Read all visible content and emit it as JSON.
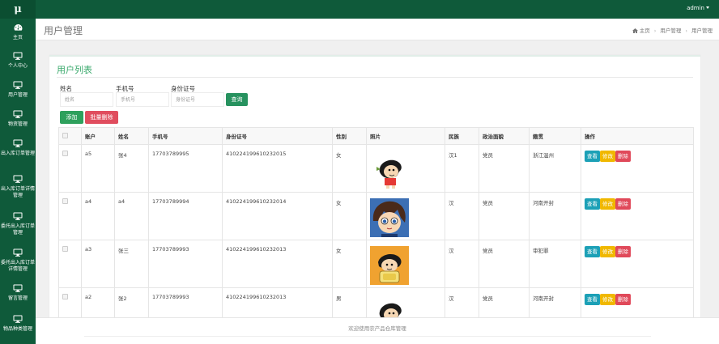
{
  "topbar": {
    "logo": "μ",
    "user": "admin"
  },
  "sidebar": {
    "items": [
      {
        "label": "主页",
        "icon": "dashboard-icon"
      },
      {
        "label": "个人中心",
        "icon": "monitor-icon"
      },
      {
        "label": "用户管理",
        "icon": "monitor-icon"
      },
      {
        "label": "物资管理",
        "icon": "monitor-icon"
      },
      {
        "label": "出入库订单管理",
        "icon": "monitor-icon"
      },
      {
        "label": "出入库订单详情管理",
        "icon": "monitor-icon"
      },
      {
        "label": "委托出入库订单管理",
        "icon": "monitor-icon"
      },
      {
        "label": "委托出入库订单详情管理",
        "icon": "monitor-icon"
      },
      {
        "label": "留言管理",
        "icon": "monitor-icon"
      },
      {
        "label": "物品种类管理",
        "icon": "monitor-icon"
      }
    ]
  },
  "header": {
    "title": "用户管理",
    "breadcrumb": [
      "主页",
      "用户管理",
      "用户管理"
    ]
  },
  "panel": {
    "title": "用户列表"
  },
  "search": {
    "name_label": "姓名",
    "name_placeholder": "姓名",
    "phone_label": "手机号",
    "phone_placeholder": "手机号",
    "idcard_label": "身份证号",
    "idcard_placeholder": "身份证号",
    "button": "查询"
  },
  "actions": {
    "add": "添加",
    "batch_delete": "批量删除"
  },
  "table": {
    "headers": [
      "账户",
      "姓名",
      "手机号",
      "身份证号",
      "性别",
      "照片",
      "民族",
      "政治面貌",
      "籍贯",
      "操作"
    ],
    "row_actions": {
      "view": "查看",
      "edit": "修改",
      "delete": "删除"
    },
    "rows": [
      {
        "account": "a5",
        "name": "张4",
        "phone": "17703789995",
        "idcard": "410224199610232015",
        "gender": "女",
        "photo": "cartoon-boy-avatar",
        "ethnicity": "汉1",
        "political": "党员",
        "hometown": "浙江温州"
      },
      {
        "account": "a4",
        "name": "a4",
        "phone": "17703789994",
        "idcard": "410224199610232014",
        "gender": "女",
        "photo": "cartoon-detective-avatar",
        "ethnicity": "汉",
        "political": "党员",
        "hometown": "河南开封"
      },
      {
        "account": "a3",
        "name": "张三",
        "phone": "17703789993",
        "idcard": "410224199610232013",
        "gender": "女",
        "photo": "cartoon-boy-backpack-avatar",
        "ethnicity": "汉",
        "political": "党员",
        "hometown": "审犯罪"
      },
      {
        "account": "a2",
        "name": "张2",
        "phone": "17703789993",
        "idcard": "410224199610232013",
        "gender": "男",
        "photo": "cartoon-boy-avatar",
        "ethnicity": "汉",
        "political": "党员",
        "hometown": "河南开封"
      }
    ]
  },
  "footer": {
    "text": "欢迎使用农产品仓库管理"
  },
  "colors": {
    "brand": "#0f5a3a",
    "accent": "#3aa96c",
    "view": "#1ca0b6",
    "edit": "#f0b800",
    "delete": "#e0495a"
  }
}
